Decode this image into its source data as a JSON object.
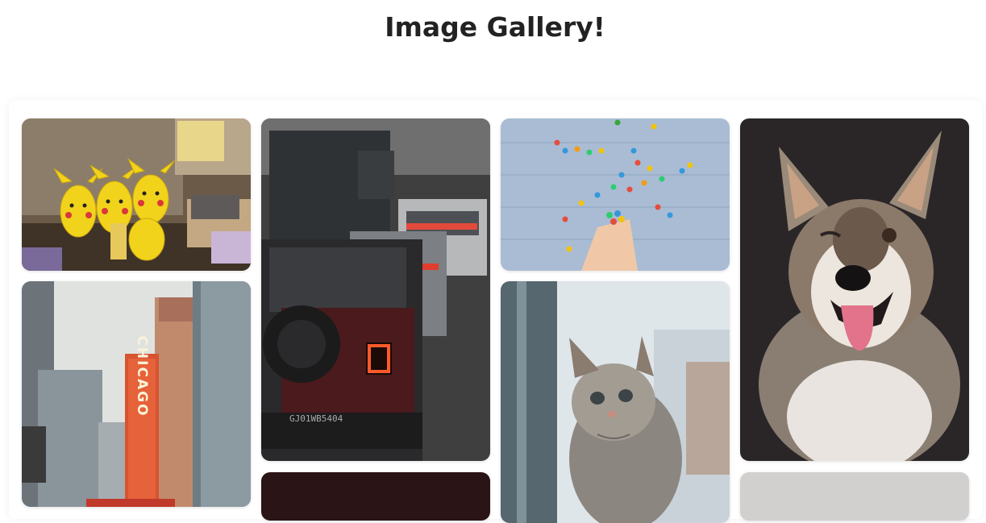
{
  "page": {
    "title": "Image Gallery!"
  },
  "gallery": {
    "images": [
      {
        "subject": "pikachu-plush-toys"
      },
      {
        "subject": "chicago-theatre-sign"
      },
      {
        "subject": "traffic-red-jeep"
      },
      {
        "subject": "dark-photo"
      },
      {
        "subject": "colorful-candies-on-wood"
      },
      {
        "subject": "fluffy-kitten-at-window"
      },
      {
        "subject": "husky-puppy-winking"
      },
      {
        "subject": "gray-photo"
      }
    ],
    "chicago_sign_text": "CHICAGO",
    "license_plate_text": "GJ01WB5404"
  },
  "colors": {
    "title": "#222222",
    "card_background": "#ffffff"
  }
}
